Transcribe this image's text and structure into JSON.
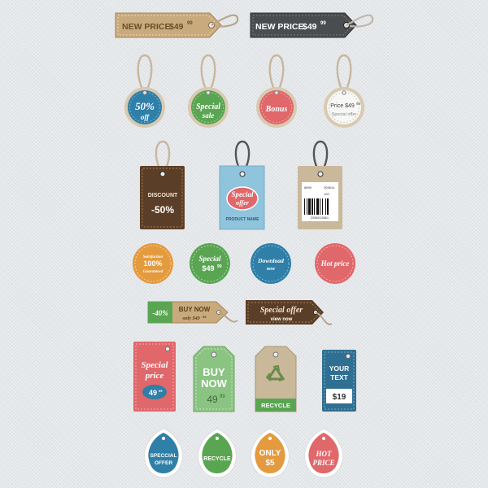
{
  "row1": {
    "tag_kraft": {
      "label": "NEW PRICE",
      "price": "$49",
      "cents": "99"
    },
    "tag_dark": {
      "label": "NEW PRICE",
      "price": "$49",
      "cents": "99"
    }
  },
  "row2": {
    "blue": {
      "line1": "50%",
      "line2": "off"
    },
    "green": {
      "line1": "Special",
      "line2": "sale"
    },
    "red": {
      "line1": "Bonus"
    },
    "white": {
      "line1": "Price $49",
      "cents": "99",
      "line2": "Special offer"
    }
  },
  "row3": {
    "leather": {
      "line1": "DISCOUNT",
      "line2": "-50%"
    },
    "blue_card": {
      "line1": "Special",
      "line2": "offer",
      "footer": "PRODUCT NAME"
    },
    "kraft_card": {
      "code1": "8899",
      "code2": "309614",
      "code3": "120",
      "barcode_num": "2056013661"
    }
  },
  "row4": {
    "orange": {
      "line1": "Satisfaction",
      "line2": "100%",
      "line3": "Guaranteed"
    },
    "green": {
      "line1": "Special",
      "line2": "$49",
      "cents": "99"
    },
    "blue": {
      "line1": "Download",
      "line2": "now"
    },
    "red": {
      "line1": "Hot price"
    }
  },
  "row5": {
    "buy_tag": {
      "discount": "-40%",
      "line1": "BUY NOW",
      "line2": "only $49",
      "cents": "99"
    },
    "offer_tag": {
      "line1": "Special offer",
      "line2": "view now"
    }
  },
  "row6": {
    "red_card": {
      "line1": "Special",
      "line2": "price",
      "price": "49",
      "cents": "99"
    },
    "green_tag": {
      "line1": "BUY",
      "line2": "NOW",
      "price": "49",
      "cents": "99"
    },
    "recycle_tag": {
      "label": "RECYCLE"
    },
    "blue_card": {
      "line1": "YOUR",
      "line2": "TEXT",
      "price": "$19"
    }
  },
  "row7": {
    "blue": {
      "line1": "SPECCIAL",
      "line2": "OFFER"
    },
    "green": {
      "line1": "RECYCLE"
    },
    "orange": {
      "line1": "ONLY",
      "line2": "$5"
    },
    "red": {
      "line1": "HOT",
      "line2": "PRICE"
    }
  },
  "colors": {
    "kraft": "#c9aa7c",
    "dark": "#4a4d50",
    "blue": "#2f7fa8",
    "green": "#5aa552",
    "red": "#e0676a",
    "orange": "#e49a3e",
    "leather": "#5b3e27",
    "lightblue": "#8fc4dc"
  }
}
